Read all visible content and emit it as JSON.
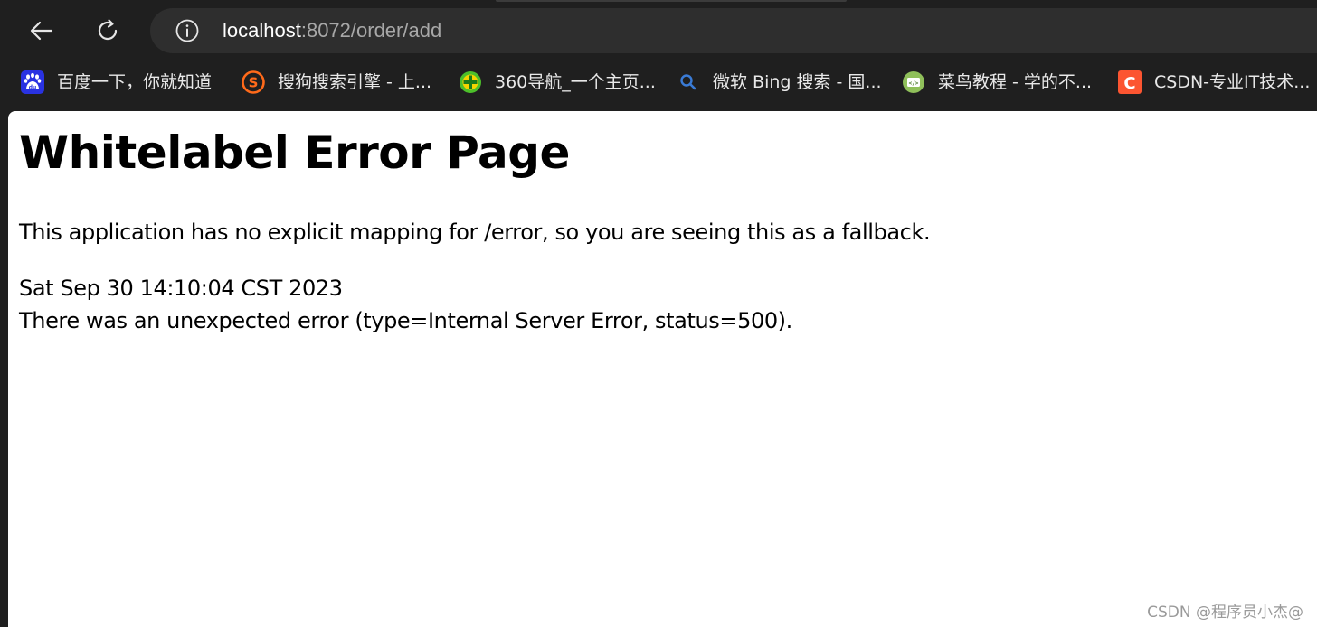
{
  "browser": {
    "url_host": "localhost",
    "url_path": ":8072/order/add",
    "icons": {
      "back": "back-arrow-icon",
      "reload": "reload-icon",
      "site_info": "info-icon"
    }
  },
  "bookmarks": [
    {
      "label": "百度一下，你就知道",
      "icon": "baidu-icon",
      "color": "#2932e1"
    },
    {
      "label": "搜狗搜索引擎 - 上...",
      "icon": "sogou-icon",
      "color": "#ff6a1a"
    },
    {
      "label": "360导航_一个主页...",
      "icon": "360-icon",
      "color": "#4cc02a"
    },
    {
      "label": "微软 Bing 搜索 - 国...",
      "icon": "search-icon",
      "color": "#3a7bd5"
    },
    {
      "label": "菜鸟教程 - 学的不...",
      "icon": "runoob-icon",
      "color": "#8fbf5a"
    },
    {
      "label": "CSDN-专业IT技术...",
      "icon": "csdn-icon",
      "color": "#fc5531"
    }
  ],
  "page": {
    "title": "Whitelabel Error Page",
    "message": "This application has no explicit mapping for /error, so you are seeing this as a fallback.",
    "timestamp": "Sat Sep 30 14:10:04 CST 2023",
    "error": "There was an unexpected error (type=Internal Server Error, status=500)."
  },
  "watermark": "CSDN @程序员小杰@"
}
